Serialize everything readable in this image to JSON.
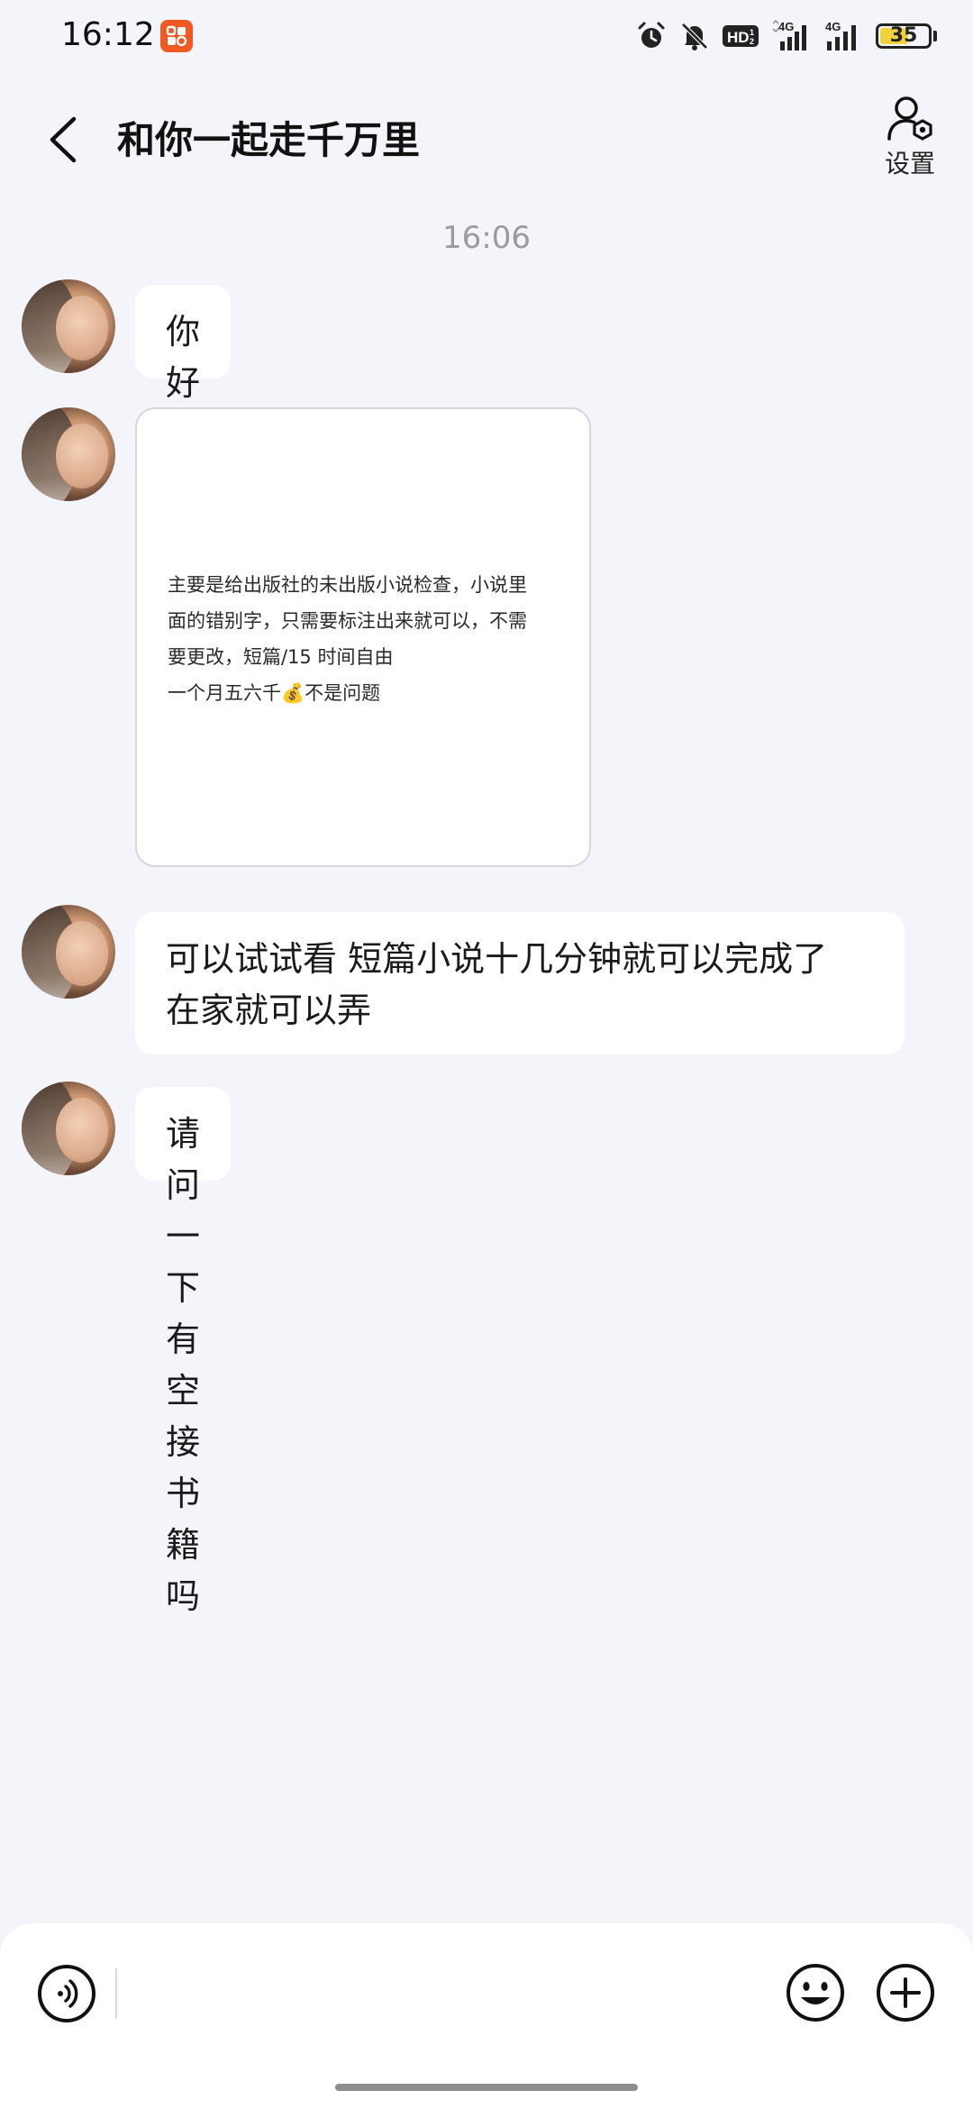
{
  "status_bar": {
    "time": "16:12",
    "network_badge": "HD",
    "signal_1_label": "4G",
    "signal_2_label": "4G",
    "battery_level": "35",
    "icons": [
      "app-badge-icon",
      "alarm-icon",
      "mute-bell-icon",
      "hd-icon",
      "signal-4g-icon",
      "signal-4g-icon",
      "battery-icon"
    ]
  },
  "header": {
    "title": "和你一起走千万里",
    "settings_label": "设置",
    "icons": [
      "back-arrow-icon",
      "user-settings-icon"
    ]
  },
  "chat": {
    "timestamp": "16:06",
    "messages": [
      {
        "type": "text",
        "text": "你好呀"
      },
      {
        "type": "image",
        "lines": [
          "主要是给出版社的未出版小说检查，小说里",
          "面的错别字，只需要标注出来就可以，不需",
          "要更改，短篇/15  时间自由",
          "一个月五六千💰不是问题"
        ]
      },
      {
        "type": "text",
        "lines": [
          "可以试试看 短篇小说十几分钟就可以完成了",
          "在家就可以弄"
        ]
      },
      {
        "type": "text",
        "text": "请问一下 有空接书籍吗"
      }
    ]
  },
  "input_bar": {
    "icons": [
      "voice-icon",
      "emoji-icon",
      "plus-icon"
    ]
  },
  "colors": {
    "background": "#f4f5fa",
    "bubble": "#ffffff",
    "app_badge": "#f05a22",
    "battery_fill": "#f2d23b"
  }
}
